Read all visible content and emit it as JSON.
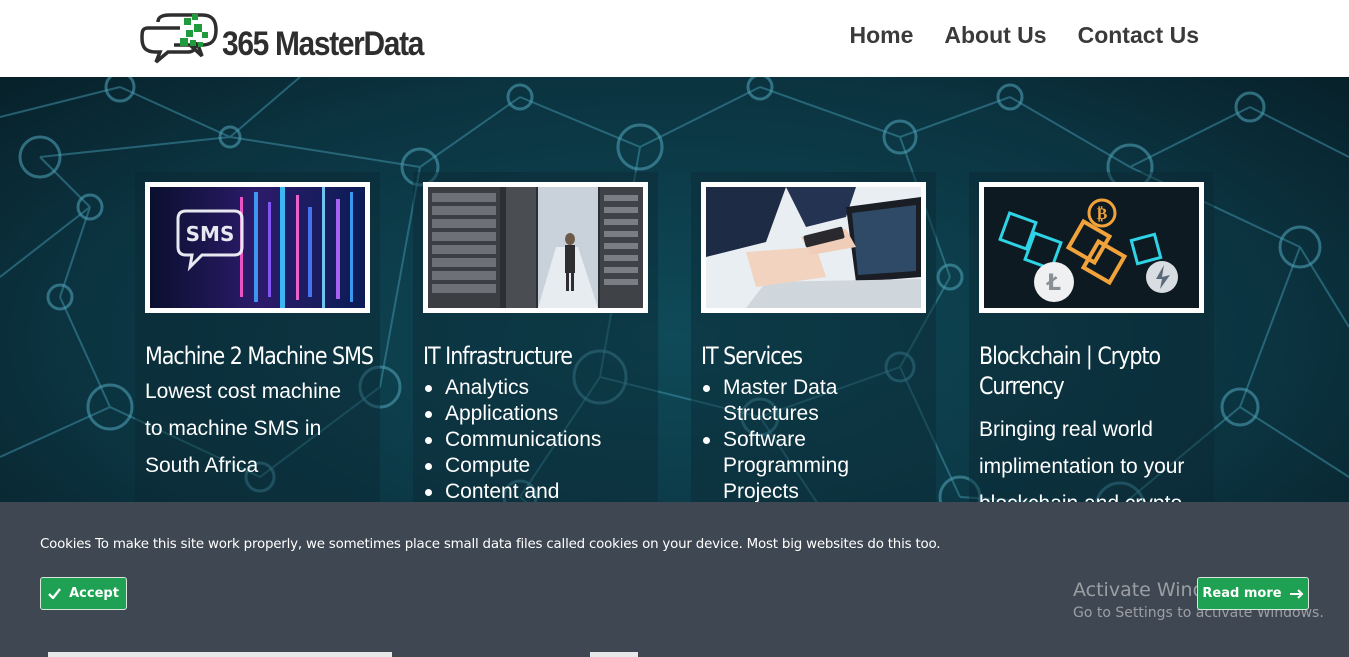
{
  "brand": {
    "name": "365 MasterData",
    "colors": {
      "logo_green": "#1f9b3b",
      "logo_dark": "#2e2e2e"
    }
  },
  "nav": {
    "items": [
      "Home",
      "About Us",
      "Contact Us"
    ]
  },
  "cards": [
    {
      "image_icon": "sms-image",
      "image_text": "SMS",
      "title": "Machine 2 Machine SMS",
      "description_lines": [
        "Lowest cost machine",
        "to machine SMS in",
        "South Africa"
      ]
    },
    {
      "image_icon": "server-room-image",
      "title": "IT Infrastructure",
      "items": [
        "Analytics",
        "Applications",
        "Communications",
        "Compute",
        "Content and"
      ]
    },
    {
      "image_icon": "laptop-work-image",
      "title": "IT Services",
      "items": [
        "Master Data Structures",
        "Software Programming Projects"
      ]
    },
    {
      "image_icon": "crypto-coins-image",
      "title_lines": [
        "Blockchain | Crypto",
        "Currency"
      ],
      "description_lines": [
        "Bringing real world",
        "implimentation to your",
        "blockchain and crypto"
      ]
    }
  ],
  "cookie_bar": {
    "message": "Cookies To make this site work properly, we sometimes place small data files called cookies on your device. Most big websites do this too.",
    "accept_label": "Accept",
    "read_more_label": "Read more",
    "colors": {
      "background": "#3f4752",
      "button": "#1ea152"
    }
  },
  "watermark": {
    "title": "Activate Windows",
    "subtitle": "Go to Settings to activate Windows."
  }
}
